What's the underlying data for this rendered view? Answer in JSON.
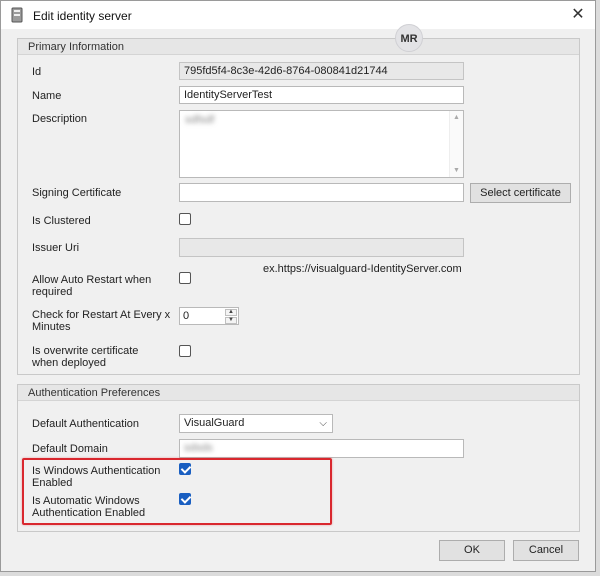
{
  "window": {
    "title": "Edit identity server",
    "avatar_initials": "MR"
  },
  "primary": {
    "header": "Primary Information",
    "id_label": "Id",
    "id_value": "795fd5f4-8c3e-42d6-8764-080841d21744",
    "name_label": "Name",
    "name_value": "IdentityServerTest",
    "description_label": "Description",
    "description_value": "sdfsdf",
    "signing_label": "Signing Certificate",
    "signing_value": "",
    "select_cert_label": "Select certificate",
    "clustered_label": "Is Clustered",
    "clustered_checked": false,
    "issuer_label": "Issuer Uri",
    "issuer_value": "",
    "issuer_hint": "ex.https://visualguard-IdentityServer.com",
    "auto_restart_label_1": "Allow Auto Restart when",
    "auto_restart_label_2": "required",
    "auto_restart_checked": false,
    "restart_minutes_label_1": "Check for Restart At Every x",
    "restart_minutes_label_2": "Minutes",
    "restart_minutes_value": "0",
    "overwrite_label_1": "Is overwrite certificate",
    "overwrite_label_2": "when deployed",
    "overwrite_checked": false
  },
  "auth": {
    "header": "Authentication Preferences",
    "default_auth_label": "Default Authentication",
    "default_auth_value": "VisualGuard",
    "default_domain_label": "Default Domain",
    "default_domain_value": "sdsds",
    "windows_auth_label_1": "Is Windows Authentication",
    "windows_auth_label_2": "Enabled",
    "windows_auth_checked": true,
    "auto_windows_label_1": "Is Automatic Windows",
    "auto_windows_label_2": "Authentication Enabled",
    "auto_windows_checked": true
  },
  "footer": {
    "ok_label": "OK",
    "cancel_label": "Cancel"
  },
  "colors": {
    "accent_checkbox": "#1a5fc1",
    "highlight_border": "#d9272e"
  },
  "icons": {
    "title_icon": "server-icon",
    "close_icon": "close-icon"
  }
}
